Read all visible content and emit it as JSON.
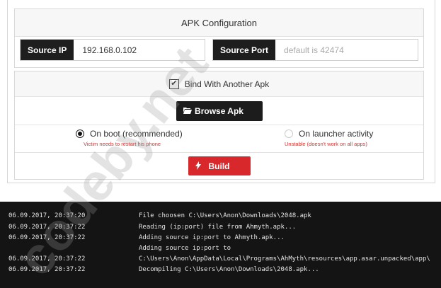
{
  "apk_config": {
    "title": "APK Configuration",
    "source_ip": {
      "label": "Source IP",
      "value": "192.168.0.102"
    },
    "source_port": {
      "label": "Source Port",
      "placeholder": "default is 42474"
    }
  },
  "bind": {
    "label": "Bind With Another Apk",
    "checked": true,
    "browse_label": "Browse Apk",
    "options": [
      {
        "label": "On boot (recommended)",
        "hint": "Victim needs to restart his phone",
        "selected": true
      },
      {
        "label": "On launcher activity",
        "hint": "Unstable (doesn't work on all apps)",
        "selected": false
      }
    ],
    "build_label": "Build"
  },
  "log": [
    {
      "time": "06.09.2017, 20:37:20",
      "msg": "File choosen C:\\Users\\Anon\\Downloads\\2048.apk"
    },
    {
      "time": "06.09.2017, 20:37:22",
      "msg": "Reading (ip:port) file from Ahmyth.apk..."
    },
    {
      "time": "06.09.2017, 20:37:22",
      "msg": "Adding source ip:port to Ahmyth.apk..."
    },
    {
      "time": "",
      "msg": "Adding source ip:port to"
    },
    {
      "time": "06.09.2017, 20:37:22",
      "msg": "C:\\Users\\Anon\\AppData\\Local\\Programs\\AhMyth\\resources\\app.asar.unpacked\\app\\"
    },
    {
      "time": "06.09.2017, 20:37:22",
      "msg": "Decompiling C:\\Users\\Anon\\Downloads\\2048.apk..."
    }
  ],
  "watermark": "codeby.net",
  "colors": {
    "accent_red": "#d9282b",
    "dark": "#1c1c1c",
    "console_bg": "#141414",
    "hint_red": "#d9302c"
  }
}
